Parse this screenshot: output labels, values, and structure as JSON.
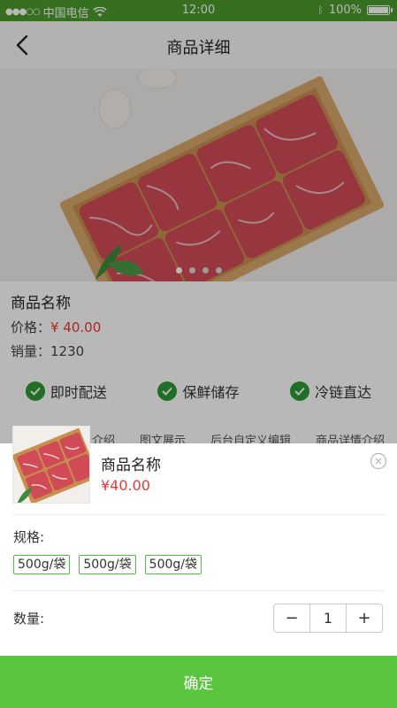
{
  "status_bar": {
    "carrier": "中国电信",
    "time": "12:00",
    "battery": "100%"
  },
  "nav": {
    "title": "商品详细"
  },
  "carousel": {
    "page_count": 4,
    "active_index": 0
  },
  "product": {
    "name": "商品名称",
    "price_label": "价格：",
    "price": "¥ 40.00",
    "sales_label": "销量：",
    "sales": "1230"
  },
  "features": [
    {
      "label": "即时配送"
    },
    {
      "label": "保鲜储存"
    },
    {
      "label": "冷链直达"
    }
  ],
  "tabs": [
    "介绍",
    "图文展示",
    "后台自定义编辑",
    "商品详情介绍"
  ],
  "sheet": {
    "name": "商品名称",
    "price": "¥40.00",
    "spec_label": "规格:",
    "spec_options": [
      "500g/袋",
      "500g/袋",
      "500g/袋"
    ],
    "quantity_label": "数量:",
    "quantity": "1",
    "minus": "−",
    "plus": "+",
    "confirm": "确定"
  },
  "colors": {
    "status_green": "#4a9a2c",
    "confirm_green": "#5ac53e",
    "price_red": "#e53935",
    "check_green": "#2f9a35"
  }
}
